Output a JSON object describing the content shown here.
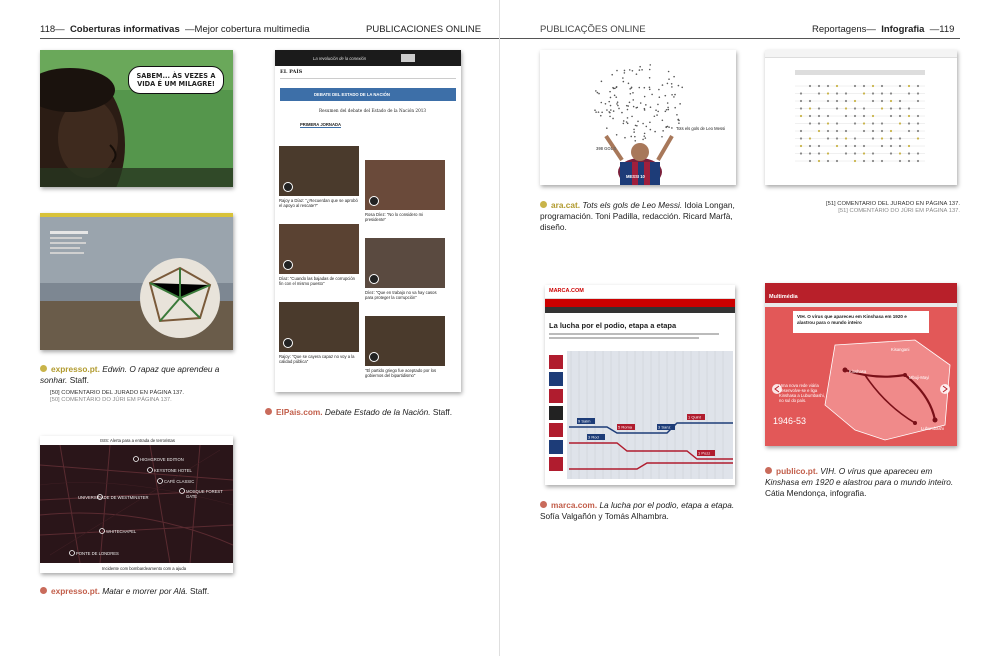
{
  "left_page": {
    "number": "118",
    "section": "Coberturas informativas",
    "subsection": "Mejor cobertura multimedia",
    "category": "PUBLICACIONES ONLINE"
  },
  "right_page": {
    "number": "119",
    "category": "PUBLICAÇÕES ONLINE",
    "section": "Reportagens",
    "subsection": "Infografia"
  },
  "entries": {
    "expresso_edwin": {
      "source": "expresso.pt.",
      "title": "Edwin. O rapaz que aprendeu a sonhar.",
      "credits": "Staff.",
      "note_es": "[50] COMENTARIO DEL JURADO EN PÁGINA 137.",
      "note_pt": "[50] COMENTÁRIO DO JÚRI EM PÁGINA 137.",
      "bubble": "SABEM... ÀS VEZES A VIDA É UM MILAGRE!",
      "dot_color": "#c9b44a"
    },
    "elpais": {
      "source": "ElPais.com.",
      "title": "Debate Estado de la Nación.",
      "credits": "Staff.",
      "dot_color": "#c96b5b",
      "site_logo": "EL PAÍS",
      "banner": "DEBATE DEL ESTADO DE LA NACIÓN",
      "subtitle": "Resumen del debate del Estado de la Nación 2013",
      "tab": "PRIMERA JORNADA",
      "ad_text": "La revolución de la conexión",
      "video_captions": [
        "Rajoy a Díaz: \"¿Recuerdan que se aprobó el apoyo al rescate?\"",
        "Rosa Díez: \"No lo considero mi presidente\"",
        "Díaz: \"Cuando las bajadas de corrupción fin con el mismo puesto\"",
        "Díez: \"Que en trabajo no va hay casos para proteger la corrupción\"",
        "Rajoy: \"Que se cayera capaz no voy a la calidad pública\"",
        "\"El partido griego fue aceptado por los gobiernos del bipartidismo\""
      ]
    },
    "expresso_ala": {
      "source": "expresso.pt.",
      "title": "Matar e morrer por Alá.",
      "credits": "Staff.",
      "dot_color": "#c96b5b",
      "map_header": "ISIS: Alerta para a entrada de terroristas",
      "map_footer": "Incidente com bombardeamento com a ajuda",
      "labels": [
        "HIGHGROVE EDITION",
        "KEYSTONE HOTEL",
        "CAFÉ CLASSIC",
        "MOSQUE FOREST GATE",
        "UNIVERSIDADE DE WESTMINSTER",
        "WHITECHAPEL",
        "PONTE DE LONDRES"
      ]
    },
    "ara": {
      "source": "ara.cat.",
      "title": "Tots els gols de Leo Messi.",
      "credits": "Idoia Longan, programación. Toni Padilla, redacción. Ricard Marfà, diseño.",
      "dot_color": "#c9b44a",
      "jersey": "MESSI 10",
      "headline": "Tots els gols de Leo Messi",
      "count": "398 GOLS"
    },
    "marca": {
      "source": "marca.com.",
      "title": "La lucha por el podio, etapa a etapa.",
      "credits": "Sofía Valgañón y Tomás Alhambra.",
      "dot_color": "#c96b5b",
      "logo": "MARCA.COM",
      "headline": "La lucha por el podio, etapa a etapa",
      "stage_labels": [
        "9 Salm",
        "5 Roma",
        "3 Sanz",
        "1 Quint",
        "3 Rod",
        "1 Pozz"
      ]
    },
    "infografia": {
      "note_es": "[51] COMENTARIO DEL JURADO EN PÁGINA 137.",
      "note_pt": "[51] COMENTÁRIO DO JÚRI EM PÁGINA 137."
    },
    "publico": {
      "source": "publico.pt.",
      "title": "VIH. O vírus que apareceu em Kinshasa em 1920 e alastrou para o mundo inteiro.",
      "credits": "Cátia Mendonça, infografia.",
      "dot_color": "#c96b5b",
      "logo": "Multimédia",
      "headline": "VIH. O vírus que apareceu em Kinshasa em 1920 e alastrou para o mundo inteiro",
      "years": "1946-53",
      "map_text": "Uma nova rede viária desenvolve-se e liga Kinshasa a Lubumbashi, no sul do país.",
      "cities": [
        "Kinshasa",
        "Mbuji-Mayi",
        "Lubumbashi",
        "Kisangani"
      ]
    }
  }
}
